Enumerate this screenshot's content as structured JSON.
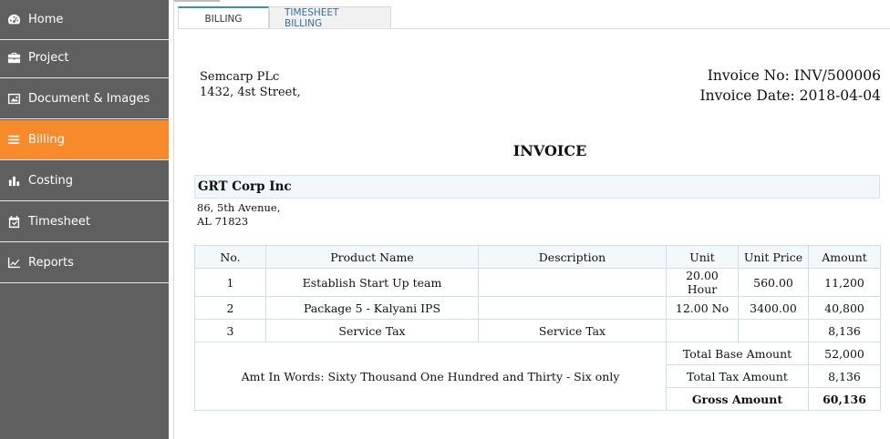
{
  "sidebar": {
    "items": [
      {
        "label": "Home",
        "icon": "dashboard-icon"
      },
      {
        "label": "Project",
        "icon": "briefcase-icon"
      },
      {
        "label": "Document & Images",
        "icon": "image-icon"
      },
      {
        "label": "Billing",
        "icon": "list-icon",
        "active": true
      },
      {
        "label": "Costing",
        "icon": "bar-chart-icon"
      },
      {
        "label": "Timesheet",
        "icon": "calendar-check-icon"
      },
      {
        "label": "Reports",
        "icon": "line-chart-icon"
      }
    ],
    "colors": {
      "background": "#5f5f5f",
      "active": "#f78a2a"
    }
  },
  "tabs": [
    {
      "label": "BILLING",
      "active": true
    },
    {
      "label": "TIMESHEET BILLING",
      "active": false
    }
  ],
  "invoice": {
    "company_name": "Semcarp PLc",
    "company_address": "1432, 4st Street,",
    "invoice_no": "Invoice No: INV/500006",
    "invoice_date": "Invoice Date: 2018-04-04",
    "title": "INVOICE",
    "client_name": "GRT Corp Inc",
    "client_address_1": "86, 5th Avenue,",
    "client_address_2": "AL 71823",
    "columns": [
      "No.",
      "Product Name",
      "Description",
      "Unit",
      "Unit Price",
      "Amount"
    ],
    "rows": [
      {
        "no": "1",
        "product": "Establish Start Up team",
        "description": "",
        "unit": "20.00 Hour",
        "unit_price": "560.00",
        "amount": "11,200"
      },
      {
        "no": "2",
        "product": "Package 5 - Kalyani IPS",
        "description": "",
        "unit": "12.00 No",
        "unit_price": "3400.00",
        "amount": "40,800"
      },
      {
        "no": "3",
        "product": "Service Tax",
        "description": "Service Tax",
        "unit": "",
        "unit_price": "",
        "amount": "8,136"
      }
    ],
    "amount_in_words": "Amt In Words: Sixty Thousand One Hundred and Thirty - Six only",
    "totals": {
      "base_label": "Total Base Amount",
      "base_value": "52,000",
      "tax_label": "Total Tax Amount",
      "tax_value": "8,136",
      "gross_label": "Gross Amount",
      "gross_value": "60,136"
    }
  }
}
